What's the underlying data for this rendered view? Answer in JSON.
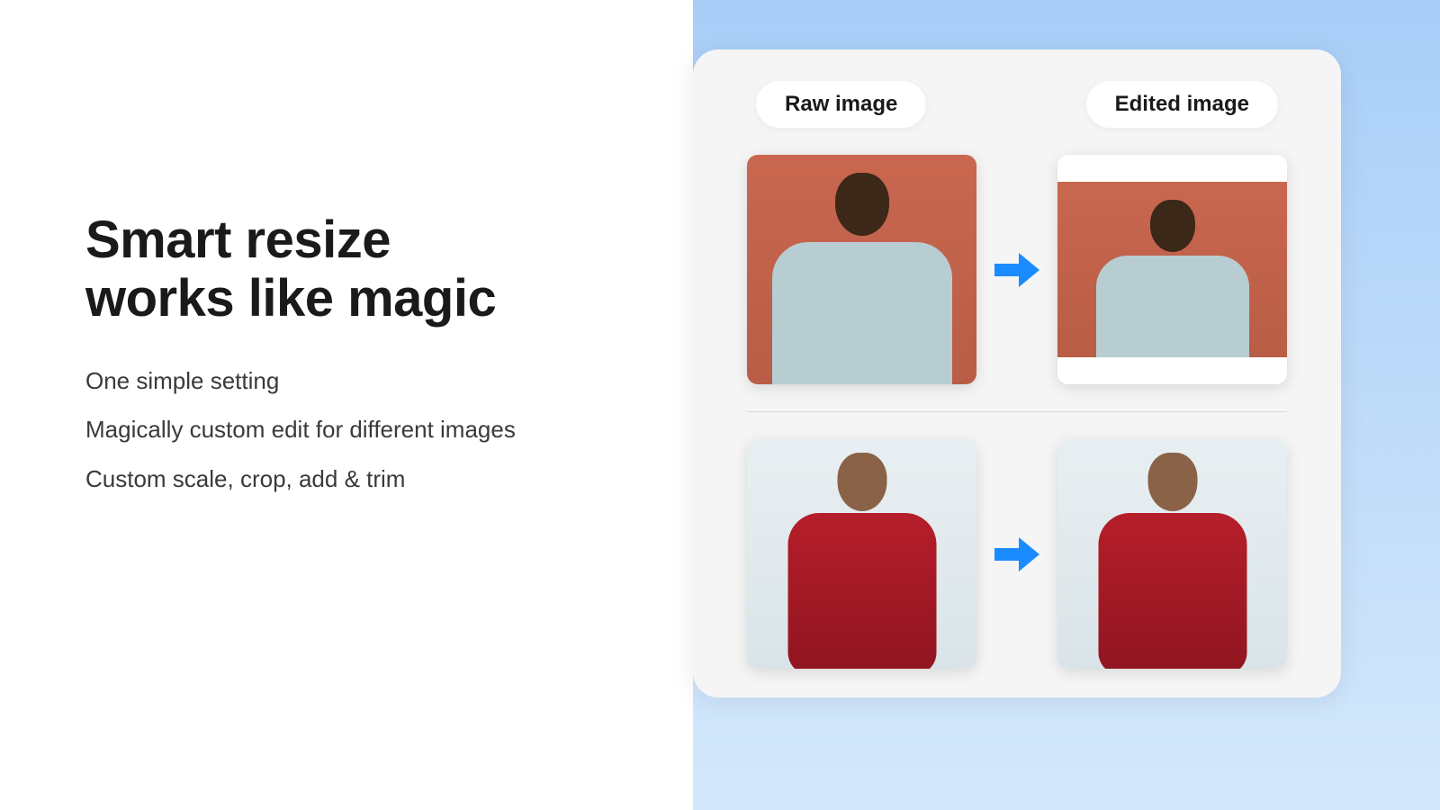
{
  "heading_line1": "Smart resize",
  "heading_line2": "works like magic",
  "features": [
    "One simple setting",
    "Magically custom edit for different images",
    "Custom scale, crop, add & trim"
  ],
  "labels": {
    "raw": "Raw image",
    "edited": "Edited image"
  },
  "icons": {
    "arrow": "arrow-right-icon"
  }
}
